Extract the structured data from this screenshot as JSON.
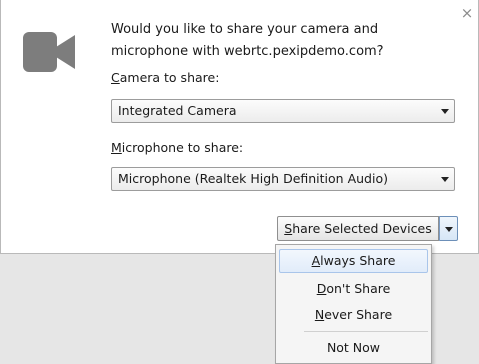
{
  "prompt": {
    "message": "Would you like to share your camera and microphone with webrtc.pexipdemo.com?",
    "close_symbol": "×"
  },
  "camera": {
    "label_accel": "C",
    "label_rest": "amera to share:",
    "selected": "Integrated Camera"
  },
  "microphone": {
    "label_accel": "M",
    "label_rest": "icrophone to share:",
    "selected": "Microphone (Realtek High Definition Audio)"
  },
  "share_button": {
    "accel": "S",
    "rest": "hare Selected Devices"
  },
  "menu": {
    "items": [
      {
        "accel": "A",
        "rest": "lways Share",
        "highlighted": true
      },
      {
        "accel": "D",
        "rest": "on't Share",
        "highlighted": false
      },
      {
        "accel": "N",
        "rest": "ever Share",
        "highlighted": false
      },
      {
        "accel": "",
        "rest": "Not Now",
        "highlighted": false
      }
    ]
  },
  "icons": {
    "camera": "video-camera-icon",
    "close": "close-icon",
    "dropdown": "chevron-down-icon"
  },
  "colors": {
    "icon_gray": "#7d7d7d",
    "panel_bg": "#ffffff",
    "backdrop": "#e6e6e6",
    "highlight_border": "#a9c5ea"
  }
}
